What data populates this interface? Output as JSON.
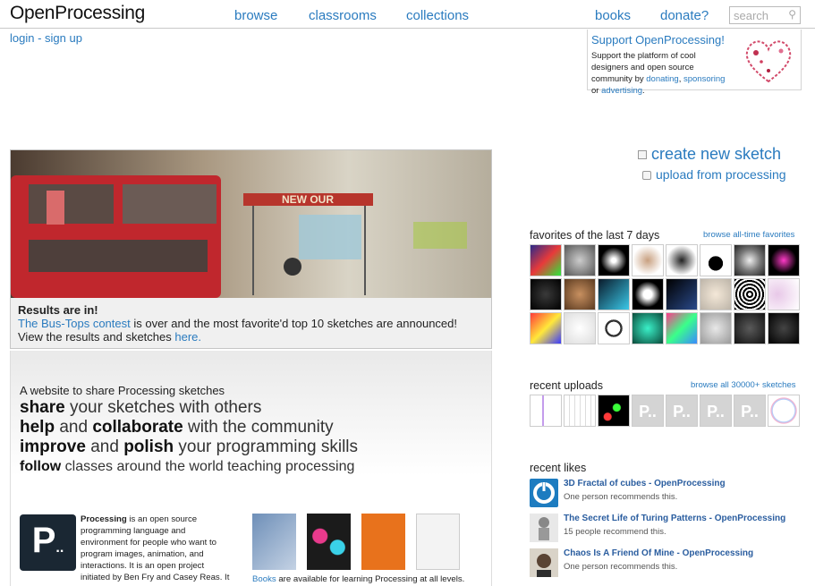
{
  "header": {
    "logo": "OpenProcessing",
    "nav": [
      "browse",
      "classrooms",
      "collections",
      "books",
      "donate?"
    ],
    "search_placeholder": "search"
  },
  "auth": {
    "login": "login",
    "separator": " - ",
    "signup": "sign up"
  },
  "support": {
    "title": "Support OpenProcessing!",
    "desc": "Support the platform of cool designers and open source community by",
    "links": [
      "donating",
      "sponsoring",
      "advertising"
    ],
    "sep1": ", ",
    "sep2": " or ",
    "end": "."
  },
  "hero": {
    "sign": "NEW OUR",
    "heading": "Results are in!",
    "link": "The Bus-Tops contest",
    "line": " is over and the most favorite'd top 10 sketches are announced!",
    "line2": "View the results and sketches ",
    "here": "here."
  },
  "intro": {
    "small": "A website to share Processing sketches",
    "lines": [
      {
        "a": "share",
        "b": " your sketches with others"
      },
      {
        "a": "help",
        "b": " and ",
        "c": "collaborate",
        "d": " with the community"
      },
      {
        "a": "improve",
        "b": " and ",
        "c": "polish",
        "d": " your programming skills"
      },
      {
        "a": "follow",
        "b": " classes around the world teaching processing"
      }
    ],
    "processing_bold": "Processing",
    "processing_desc": " is an open source programming language and environment for people who want to program images, animation, and interactions. It is an open project initiated by Ben Fry and Casey Reas. It",
    "books_link": "Books",
    "books_caption": " are available for learning Processing at all levels."
  },
  "actions": {
    "create": "create new sketch",
    "upload": "upload from processing"
  },
  "favorites": {
    "title": "favorites of the last 7 days",
    "link": "browse all-time favorites"
  },
  "recent": {
    "title": "recent uploads",
    "link": "browse all 30000+ sketches",
    "placeholder_glyph": "P.."
  },
  "likes": {
    "title": "recent likes",
    "items": [
      {
        "title": "3D Fractal of cubes - OpenProcessing",
        "sub": "One person recommends this."
      },
      {
        "title": "The Secret Life of Turing Patterns - OpenProcessing",
        "sub": "15 people recommend this."
      },
      {
        "title": "Chaos Is A Friend Of Mine - OpenProcessing",
        "sub": "One person recommends this."
      }
    ]
  },
  "colors": {
    "link": "#2a7bbf",
    "likes_title": "#2a5d9f",
    "bus_red": "#c0272d"
  }
}
